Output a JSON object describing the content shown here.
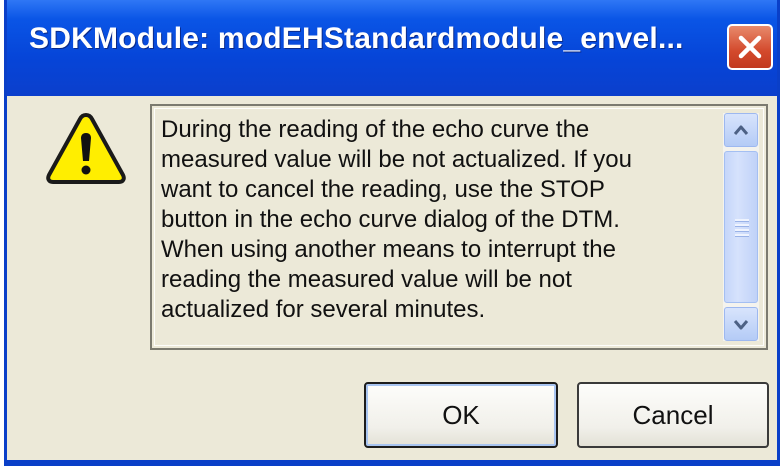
{
  "window": {
    "title": "SDKModule: modEHStandardmodule_envel..."
  },
  "message": {
    "text": "During the reading of the echo curve the\nmeasured value will be not actualized. If you\nwant to cancel the reading, use the STOP\nbutton in the echo curve dialog of the DTM.\nWhen using another means to interrupt the\nreading the measured value will be not\nactualized for several minutes."
  },
  "buttons": {
    "ok_label": "OK",
    "cancel_label": "Cancel"
  },
  "icons": {
    "warning": "warning-icon",
    "close": "close-icon",
    "scroll_up": "chevron-up-icon",
    "scroll_down": "chevron-down-icon"
  },
  "colors": {
    "titlebar": "#0645d8",
    "close_button": "#d3492c",
    "dialog_background": "#ece9d8",
    "warning_fill": "#ffee00"
  }
}
